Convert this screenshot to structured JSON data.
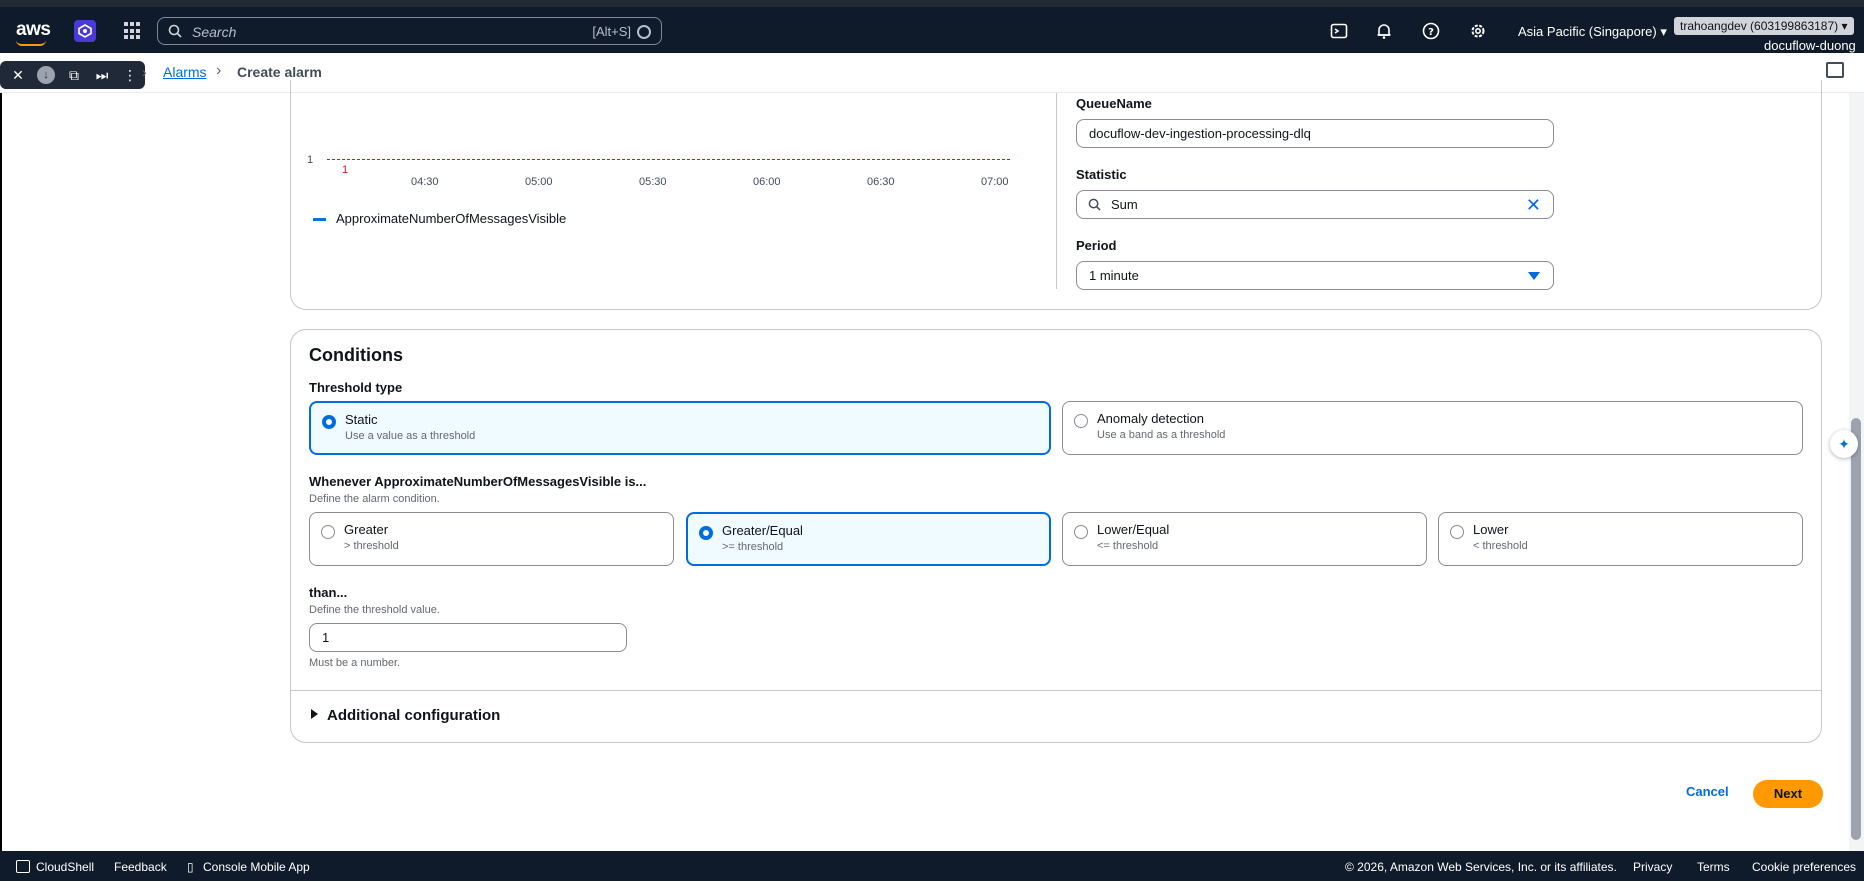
{
  "topnav": {
    "logo": "aws",
    "search_placeholder": "Search",
    "search_shortcut": "[Alt+S]",
    "region": "Asia Pacific (Singapore)",
    "account": "trahoangdev (603199863187)",
    "user": "docuflow-duong"
  },
  "breadcrumb": {
    "alarms": "Alarms",
    "current": "Create alarm"
  },
  "chart_data": {
    "type": "line",
    "x": [
      "04:30",
      "05:00",
      "05:30",
      "06:00",
      "06:30",
      "07:00"
    ],
    "series": [
      {
        "name": "ApproximateNumberOfMessagesVisible",
        "values": []
      }
    ],
    "threshold": 1,
    "threshold_label": "1",
    "y_ticks": [
      "1"
    ]
  },
  "metric": {
    "queue_label": "QueueName",
    "queue_value": "docuflow-dev-ingestion-processing-dlq",
    "statistic_label": "Statistic",
    "statistic_value": "Sum",
    "period_label": "Period",
    "period_value": "1 minute"
  },
  "conditions": {
    "title": "Conditions",
    "threshold_type_label": "Threshold type",
    "threshold_types": [
      {
        "title": "Static",
        "sub": "Use a value as a threshold",
        "selected": true
      },
      {
        "title": "Anomaly detection",
        "sub": "Use a band as a threshold",
        "selected": false
      }
    ],
    "whenever_label": "Whenever ApproximateNumberOfMessagesVisible is...",
    "whenever_desc": "Define the alarm condition.",
    "operators": [
      {
        "title": "Greater",
        "sub": "> threshold",
        "selected": false
      },
      {
        "title": "Greater/Equal",
        "sub": ">= threshold",
        "selected": true
      },
      {
        "title": "Lower/Equal",
        "sub": "<= threshold",
        "selected": false
      },
      {
        "title": "Lower",
        "sub": "< threshold",
        "selected": false
      }
    ],
    "than_label": "than...",
    "than_desc": "Define the threshold value.",
    "than_value": "1",
    "than_hint": "Must be a number.",
    "additional": "Additional configuration"
  },
  "actions": {
    "cancel": "Cancel",
    "next": "Next"
  },
  "footer": {
    "cloudshell": "CloudShell",
    "feedback": "Feedback",
    "mobile": "Console Mobile App",
    "copyright": "© 2026, Amazon Web Services, Inc. or its affiliates.",
    "privacy": "Privacy",
    "terms": "Terms",
    "cookies": "Cookie preferences"
  },
  "colors": {
    "accent": "#006ce0",
    "primary_button": "#ff9900",
    "threshold_line": "#d91515",
    "nav_bg": "#0f1b2a"
  }
}
